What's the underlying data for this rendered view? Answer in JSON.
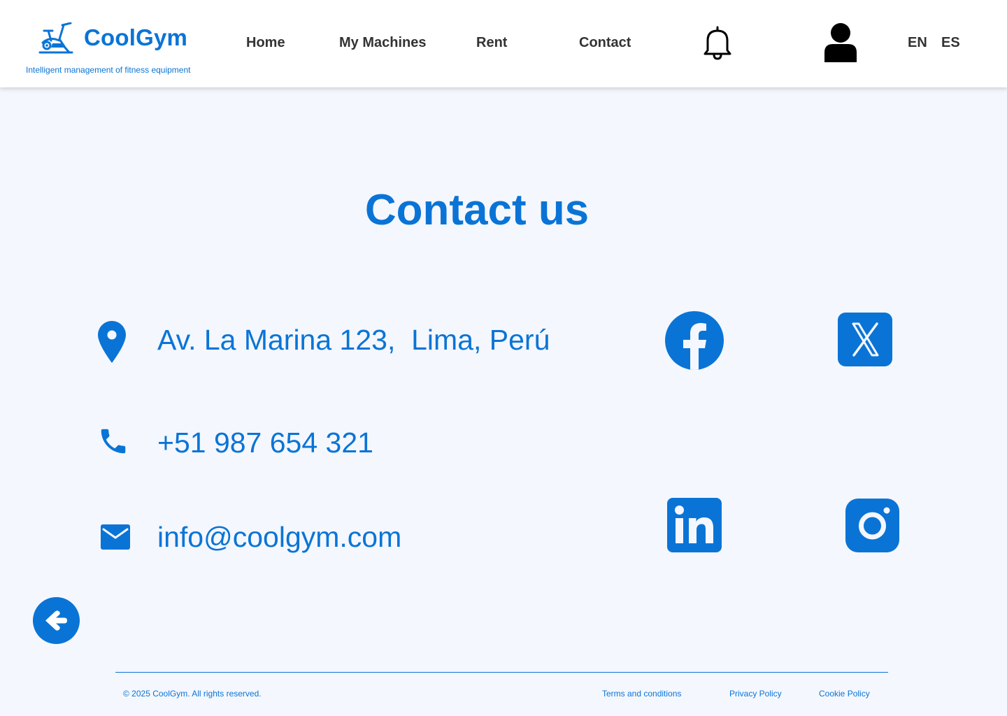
{
  "header": {
    "brand_name": "CoolGym",
    "tagline": "Intelligent management of fitness equipment",
    "nav": [
      "Home",
      "My Machines",
      "Rent",
      "Contact"
    ],
    "notifications_icon": "bell-icon",
    "profile_icon": "user-icon",
    "languages": [
      "EN",
      "ES"
    ]
  },
  "main": {
    "title": "Contact us",
    "contacts": {
      "address": "Av. La Marina 123,  Lima, Perú",
      "phone": "+51 987 654 321",
      "email": "info@coolgym.com"
    },
    "socials": [
      "facebook-icon",
      "x-icon",
      "linkedin-icon",
      "instagram-icon"
    ],
    "back_icon": "arrow-left-icon"
  },
  "footer": {
    "copyright": "© 2025 CoolGym. All rights reserved.",
    "links": [
      "Terms and conditions",
      "Privacy Policy",
      "Cookie Policy"
    ]
  },
  "colors": {
    "brand": "#0a74d6",
    "page_background": "#f4f7fd",
    "header_background": "#ffffff",
    "nav_text": "#333333"
  }
}
